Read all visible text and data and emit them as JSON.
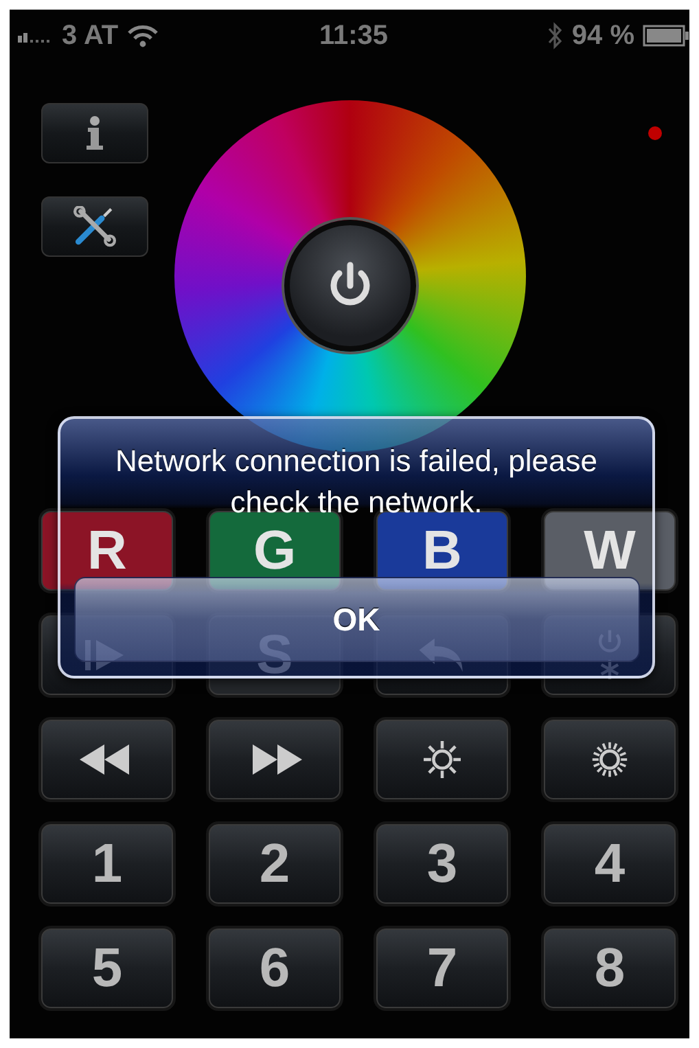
{
  "status_bar": {
    "carrier": "3 AT",
    "time": "11:35",
    "battery": "94 %"
  },
  "side_buttons": [
    {
      "kind": "info"
    },
    {
      "kind": "tools"
    }
  ],
  "keypad": [
    {
      "kind": "letter",
      "label": "R",
      "color": "#8c1426"
    },
    {
      "kind": "letter",
      "label": "G",
      "color": "#146a3c"
    },
    {
      "kind": "letter",
      "label": "B",
      "color": "#1a3a9a"
    },
    {
      "kind": "letter",
      "label": "W",
      "color": "#5a5e66"
    },
    {
      "kind": "play"
    },
    {
      "kind": "letter",
      "label": "S",
      "color": "#24272b"
    },
    {
      "kind": "undo"
    },
    {
      "kind": "power-light"
    },
    {
      "kind": "rewind"
    },
    {
      "kind": "forward"
    },
    {
      "kind": "dim"
    },
    {
      "kind": "bright"
    },
    {
      "kind": "number",
      "label": "1"
    },
    {
      "kind": "number",
      "label": "2"
    },
    {
      "kind": "number",
      "label": "3"
    },
    {
      "kind": "number",
      "label": "4"
    },
    {
      "kind": "number",
      "label": "5"
    },
    {
      "kind": "number",
      "label": "6"
    },
    {
      "kind": "number",
      "label": "7"
    },
    {
      "kind": "number",
      "label": "8"
    }
  ],
  "dialog": {
    "message": "Network connection is failed, please check the network.",
    "button": "OK"
  }
}
